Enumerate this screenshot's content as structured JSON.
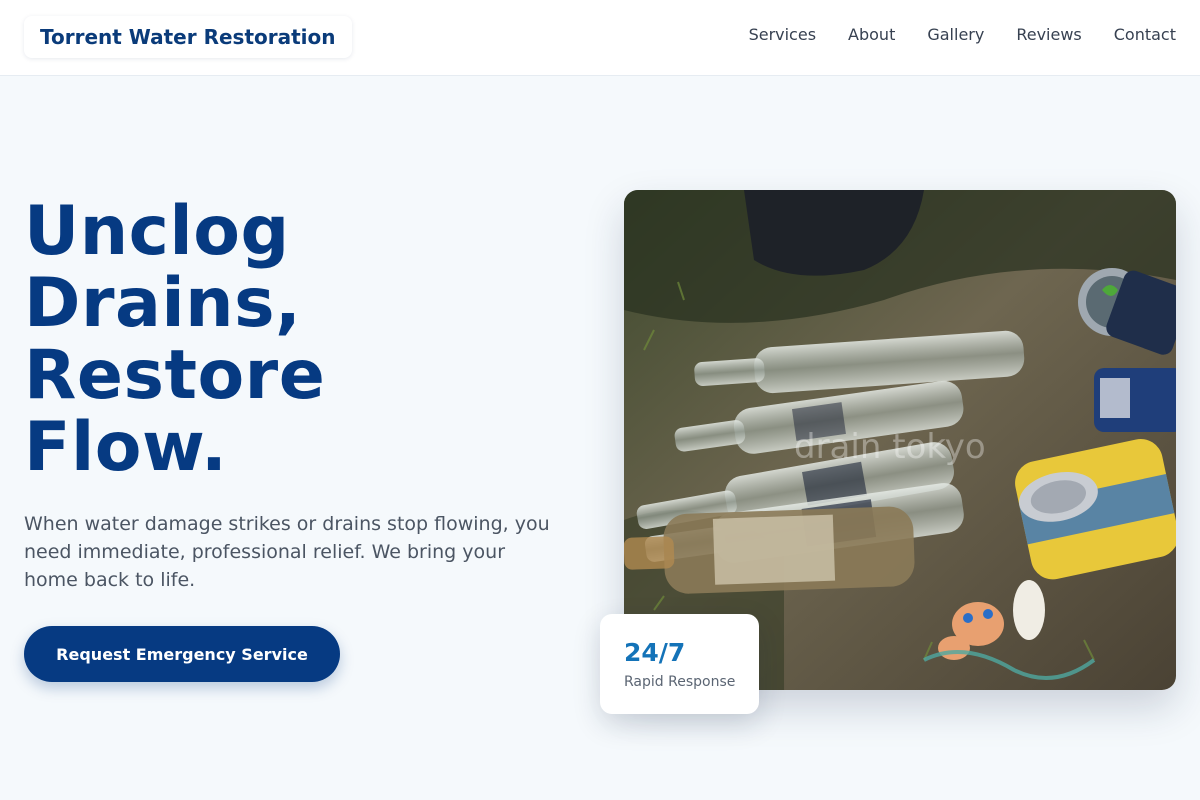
{
  "header": {
    "brand": "Torrent Water Restoration",
    "nav": [
      {
        "label": "Services"
      },
      {
        "label": "About"
      },
      {
        "label": "Gallery"
      },
      {
        "label": "Reviews"
      },
      {
        "label": "Contact"
      }
    ]
  },
  "hero": {
    "title_lines": [
      "Unclog",
      "Drains,",
      "Restore",
      "Flow."
    ],
    "subtitle": "When water damage strikes or drains stop flowing, you need immediate, professional relief. We bring your home back to life.",
    "cta_label": "Request Emergency Service",
    "image_watermark": "drain tokyo",
    "stat": {
      "value": "24/7",
      "label": "Rapid Response"
    }
  },
  "colors": {
    "brand_blue": "#063a82",
    "accent_blue": "#1473b8",
    "page_bg": "#f5f9fc"
  }
}
